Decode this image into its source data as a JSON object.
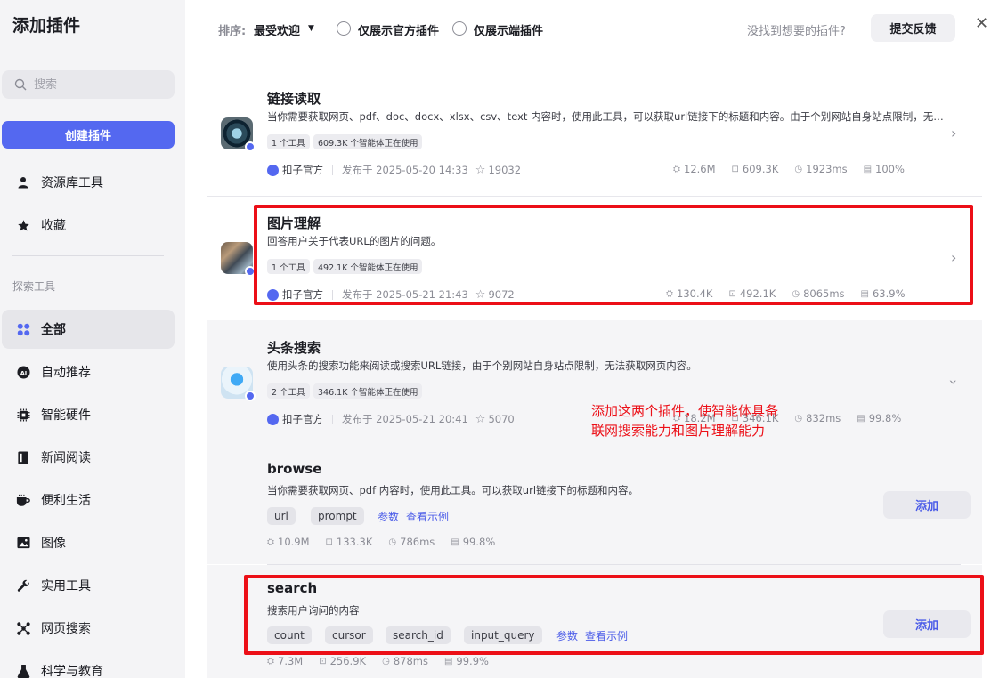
{
  "sidebar": {
    "title": "添加插件",
    "search_placeholder": "搜索",
    "create_button": "创建插件",
    "top_items": [
      {
        "label": "资源库工具",
        "icon": "user-icon"
      },
      {
        "label": "收藏",
        "icon": "star-icon"
      }
    ],
    "section_title": "探索工具",
    "categories": [
      {
        "label": "全部",
        "icon": "grid-icon",
        "active": true
      },
      {
        "label": "自动推荐",
        "icon": "ai-icon"
      },
      {
        "label": "智能硬件",
        "icon": "chip-icon"
      },
      {
        "label": "新闻阅读",
        "icon": "book-icon"
      },
      {
        "label": "便利生活",
        "icon": "cup-icon"
      },
      {
        "label": "图像",
        "icon": "image-icon"
      },
      {
        "label": "实用工具",
        "icon": "wrench-icon"
      },
      {
        "label": "网页搜索",
        "icon": "network-icon"
      },
      {
        "label": "科学与教育",
        "icon": "flask-icon"
      }
    ]
  },
  "toolbar": {
    "sort_label": "排序:",
    "sort_value": "最受欢迎",
    "filter_official": "仅展示官方插件",
    "filter_endpoint": "仅展示端插件",
    "not_found": "没找到想要的插件?",
    "feedback_button": "提交反馈"
  },
  "plugins": [
    {
      "name": "链接读取",
      "desc": "当你需要获取网页、pdf、doc、docx、xlsx、csv、text 内容时，使用此工具，可以获取url链接下的标题和内容。由于个别网站自身站点限制，无法获取网页内容。",
      "tag_tools": "1 个工具",
      "tag_users": "609.3K 个智能体正在使用",
      "author": "扣子官方",
      "published": "发布于 2025-05-20 14:33",
      "stars": "19032",
      "calls": "12.6M",
      "bots": "609.3K",
      "latency": "1923ms",
      "success": "100%"
    },
    {
      "name": "图片理解",
      "desc": "回答用户关于代表URL的图片的问题。",
      "tag_tools": "1 个工具",
      "tag_users": "492.1K 个智能体正在使用",
      "author": "扣子官方",
      "published": "发布于 2025-05-21 21:43",
      "stars": "9072",
      "calls": "130.4K",
      "bots": "492.1K",
      "latency": "8065ms",
      "success": "63.9%"
    },
    {
      "name": "头条搜索",
      "desc": "使用头条的搜索功能来阅读或搜索URL链接，由于个别网站自身站点限制，无法获取网页内容。",
      "tag_tools": "2 个工具",
      "tag_users": "346.1K 个智能体正在使用",
      "author": "扣子官方",
      "published": "发布于 2025-05-21 20:41",
      "stars": "5070",
      "calls": "18.2M",
      "bots": "346.1K",
      "latency": "832ms",
      "success": "99.8%"
    }
  ],
  "tools": [
    {
      "name": "browse",
      "desc": "当你需要获取网页、pdf 内容时，使用此工具。可以获取url链接下的标题和内容。",
      "params": [
        "url",
        "prompt"
      ],
      "link_params": "参数",
      "link_example": "查看示例",
      "add_button": "添加",
      "calls": "10.9M",
      "bots": "133.3K",
      "latency": "786ms",
      "success": "99.8%"
    },
    {
      "name": "search",
      "desc": "搜索用户询问的内容",
      "params": [
        "count",
        "cursor",
        "search_id",
        "input_query"
      ],
      "link_params": "参数",
      "link_example": "查看示例",
      "add_button": "添加",
      "calls": "7.3M",
      "bots": "256.9K",
      "latency": "878ms",
      "success": "99.9%"
    }
  ],
  "annotation": {
    "line1": "添加这两个插件，使智能体具备",
    "line2": "联网搜索能力和图片理解能力"
  },
  "colors": {
    "accent": "#5468f0",
    "highlight": "#ec0f17",
    "sidebar_bg": "#f4f4f6",
    "expanded_bg": "#f5f5f7"
  }
}
